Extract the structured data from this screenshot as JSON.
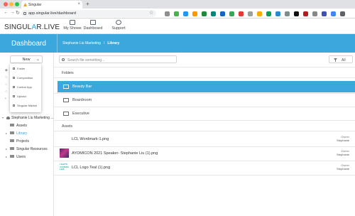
{
  "browser": {
    "tab_title": "Singular",
    "url": "app.singular.live/dashboard",
    "traffic_lights": [
      "#ff5f57",
      "#febc2e",
      "#28c840"
    ],
    "extension_colors": [
      "#8e8e8e",
      "#4caf50",
      "#2196f3",
      "#ff9800",
      "#1d8a3a",
      "#00897b",
      "#1565c0",
      "#34a853",
      "#e53935",
      "#9e9e9e",
      "#f9ab00",
      "#0f9d58",
      "#2a8ad1",
      "#7f8c8d",
      "#111111",
      "#b71c1c",
      "#888888",
      "#3f51b5",
      "#4285f4",
      "#5f6368"
    ]
  },
  "app": {
    "logo_before": "SINGUL",
    "logo_mark": "A",
    "logo_after": "R.LIVE",
    "nav": [
      {
        "label": "My Shows"
      },
      {
        "label": "Dashboard"
      },
      {
        "label": "Support"
      }
    ]
  },
  "banner": {
    "title": "Dashboard",
    "breadcrumb_parent": "Stephanie Liu Marketing",
    "breadcrumb_separator": "/",
    "breadcrumb_current": "Library"
  },
  "sidebar": {
    "new_button": "New",
    "new_menu": [
      {
        "label": "Folder",
        "icon": "folder-icon"
      },
      {
        "label": "Composition",
        "icon": "composition-icon"
      },
      {
        "label": "Control App",
        "icon": "control-app-icon"
      },
      {
        "label": "Upload",
        "icon": "upload-icon"
      },
      {
        "label": "Singular Market",
        "icon": "market-icon"
      }
    ],
    "org_name": "Stephanie Liu Marketing ...",
    "tree": [
      {
        "label": "Assets",
        "icon": "folder-icon",
        "expandable": false
      },
      {
        "label": "Library",
        "icon": "folder-icon",
        "expandable": true,
        "active": true
      },
      {
        "label": "Projects",
        "icon": "folder-icon",
        "expandable": false
      },
      {
        "label": "Singular Resources",
        "icon": "folder-icon",
        "expandable": true
      },
      {
        "label": "Users",
        "icon": "folder-icon",
        "expandable": true
      }
    ]
  },
  "main": {
    "search_placeholder": "Search file something...",
    "filter_label": "All",
    "folders_heading": "Folders",
    "folders": [
      {
        "name": "Beauty Bar",
        "selected": true
      },
      {
        "name": "Boardroom",
        "selected": false
      },
      {
        "name": "Executive",
        "selected": false
      }
    ],
    "assets_heading": "Assets",
    "owner_label": "Owner",
    "assets": [
      {
        "name": "LCL Wordmark-1.png",
        "owner": "Stephanie",
        "thumb": "none"
      },
      {
        "name": "AYOMICON 2021 Speaker- Stephanie Liu (1).png",
        "owner": "Stephanie",
        "thumb": "photo"
      },
      {
        "name": "LCL Logo Teal (1).png",
        "owner": "Stephanie",
        "thumb": "logo",
        "thumb_text": [
          "LIGHTS",
          "CAMERA",
          "LIVE"
        ]
      }
    ],
    "selection_color": "#3aa8dd"
  }
}
